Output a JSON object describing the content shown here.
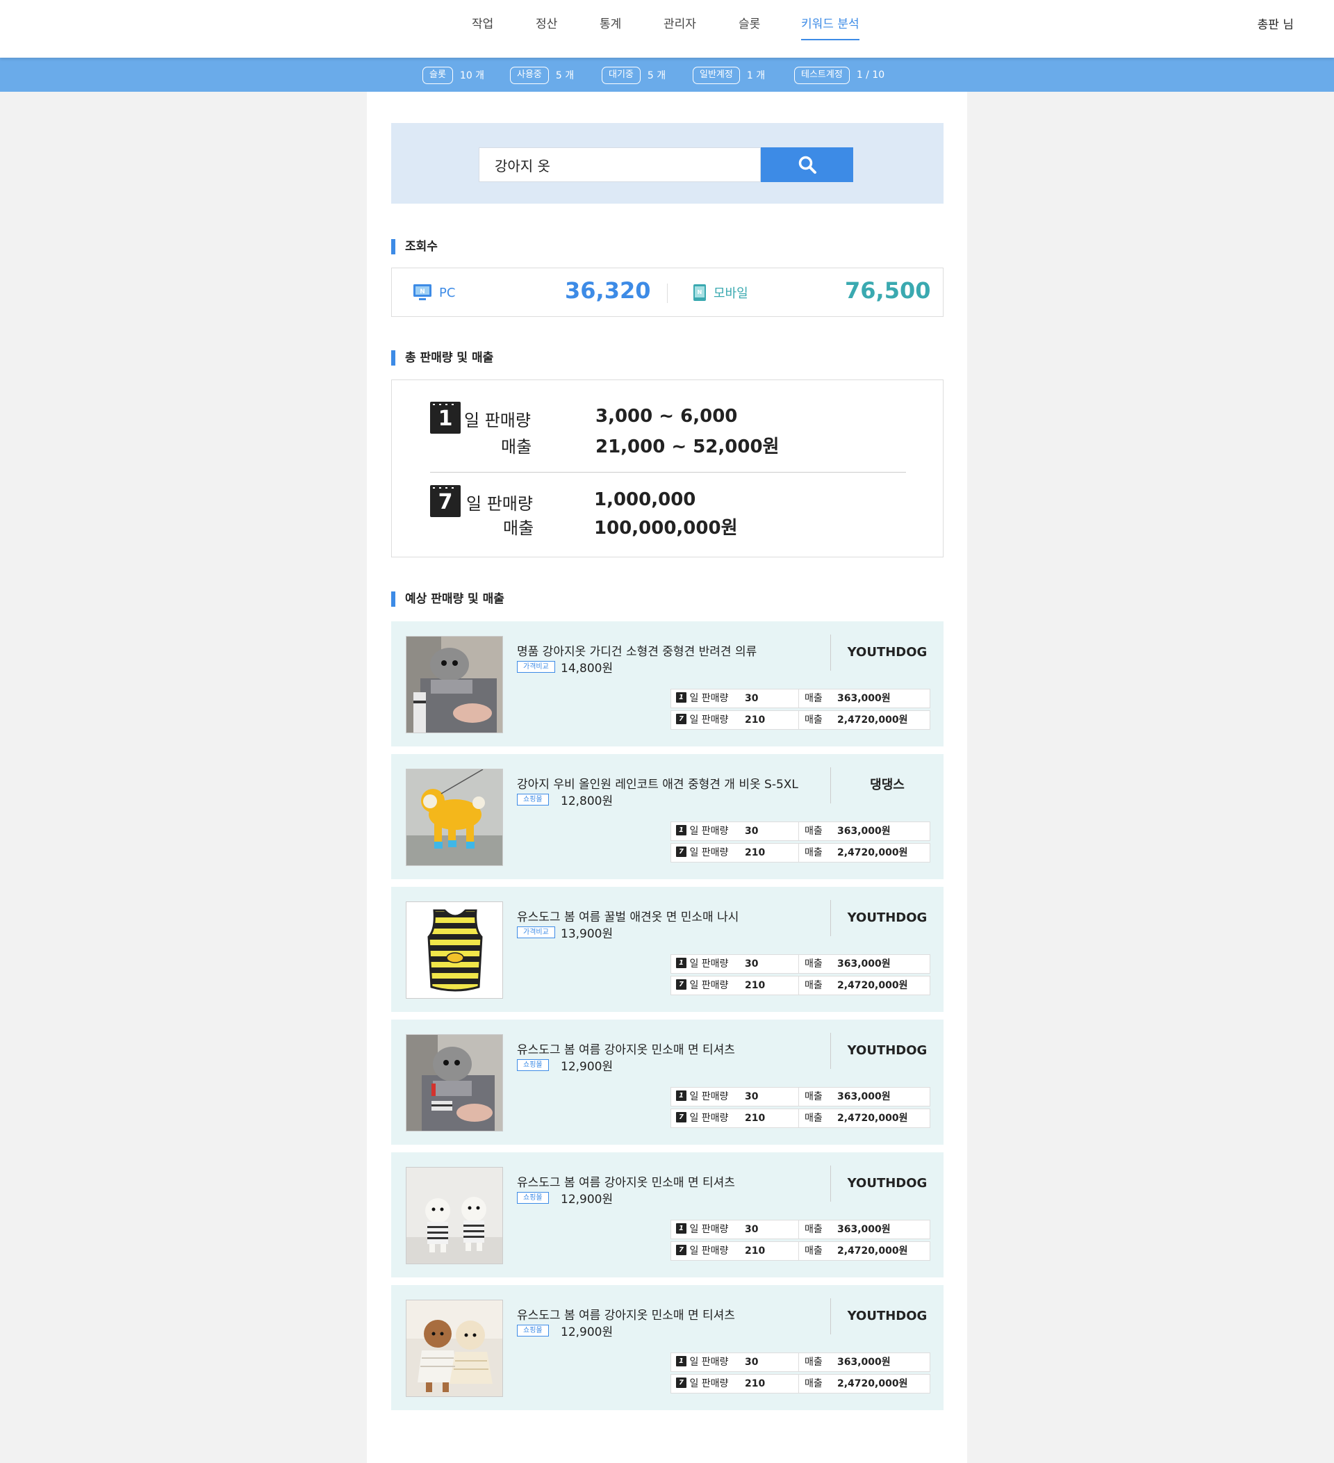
{
  "nav": {
    "items": [
      {
        "label": "작업"
      },
      {
        "label": "정산"
      },
      {
        "label": "통계"
      },
      {
        "label": "관리자"
      },
      {
        "label": "슬롯"
      },
      {
        "label": "키워드 분석"
      }
    ],
    "active_index": 5,
    "user": "총판 님"
  },
  "stats": [
    {
      "tag": "슬롯",
      "value": "10 개"
    },
    {
      "tag": "사용중",
      "value": "5 개"
    },
    {
      "tag": "대기중",
      "value": "5 개"
    },
    {
      "tag": "일반계정",
      "value": "1 개"
    },
    {
      "tag": "테스트계정",
      "value": "1 / 10"
    }
  ],
  "search": {
    "value": "강아지 옷"
  },
  "views": {
    "title": "조회수",
    "pc": {
      "label": "PC",
      "value": "36,320"
    },
    "mobile": {
      "label": "모바일",
      "value": "76,500"
    }
  },
  "totals": {
    "title": "총 판매량 및 매출",
    "day1": {
      "num": "1",
      "label": "일 판매량",
      "sales_label": "매출",
      "volume": "3,000 ~ 6,000",
      "revenue": "21,000 ~ 52,000원"
    },
    "day7": {
      "num": "7",
      "label": "일 판매량",
      "sales_label": "매출",
      "volume": "1,000,000",
      "revenue": "100,000,000원"
    }
  },
  "forecast_title": "예상 판매량 및 매출",
  "row_labels": {
    "day1_num": "1",
    "day7_num": "7",
    "volume": "일 판매량",
    "sales": "매출"
  },
  "products": [
    {
      "name": "명품 강아지옷 가디건 소형견 중형견 반려견 의류",
      "tag": "가격비교",
      "price": "14,800원",
      "brand": "YOUTHDOG",
      "d1_volume": "30",
      "d1_sales": "363,000원",
      "d7_volume": "210",
      "d7_sales": "2,4720,000원"
    },
    {
      "name": "강아지 우비 올인원 레인코트 애견 중형견 개 비옷 S-5XL",
      "tag": "쇼핑몰",
      "price": "12,800원",
      "brand": "댕댕스",
      "d1_volume": "30",
      "d1_sales": "363,000원",
      "d7_volume": "210",
      "d7_sales": "2,4720,000원"
    },
    {
      "name": "유스도그 봄 여름 꿀벌 애견옷 면 민소매 나시",
      "tag": "가격비교",
      "price": "13,900원",
      "brand": "YOUTHDOG",
      "d1_volume": "30",
      "d1_sales": "363,000원",
      "d7_volume": "210",
      "d7_sales": "2,4720,000원"
    },
    {
      "name": "유스도그 봄 여름 강아지옷 민소매 면 티셔츠",
      "tag": "쇼핑몰",
      "price": "12,900원",
      "brand": "YOUTHDOG",
      "d1_volume": "30",
      "d1_sales": "363,000원",
      "d7_volume": "210",
      "d7_sales": "2,4720,000원"
    },
    {
      "name": "유스도그 봄 여름 강아지옷 민소매 면 티셔츠",
      "tag": "쇼핑몰",
      "price": "12,900원",
      "brand": "YOUTHDOG",
      "d1_volume": "30",
      "d1_sales": "363,000원",
      "d7_volume": "210",
      "d7_sales": "2,4720,000원"
    },
    {
      "name": "유스도그 봄 여름 강아지옷 민소매 면 티셔츠",
      "tag": "쇼핑몰",
      "price": "12,900원",
      "brand": "YOUTHDOG",
      "d1_volume": "30",
      "d1_sales": "363,000원",
      "d7_volume": "210",
      "d7_sales": "2,4720,000원"
    }
  ],
  "colors": {
    "accent": "#3d8be6",
    "status_bar": "#6aabea",
    "mobile": "#3aa9b0",
    "card_bg": "#e7f4f5"
  }
}
